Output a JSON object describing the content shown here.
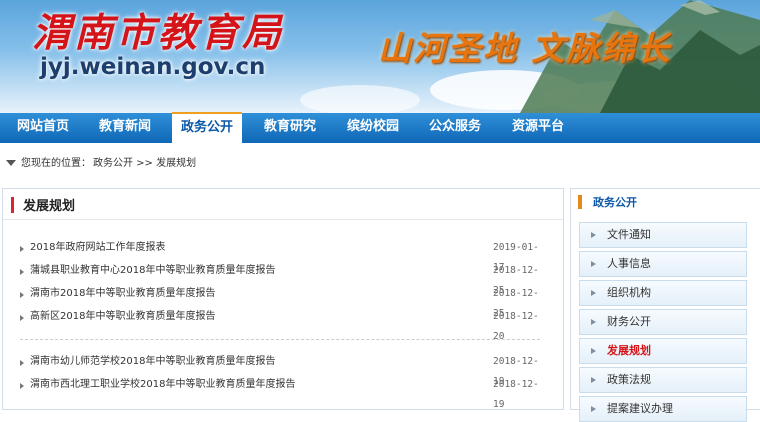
{
  "header": {
    "site_title": "渭南市教育局",
    "site_url": "jyj.weinan.gov.cn",
    "slogan": "山河圣地 文脉绵长"
  },
  "nav": {
    "items": [
      "网站首页",
      "教育新闻",
      "政务公开",
      "教育研究",
      "缤纷校园",
      "公众服务",
      "资源平台"
    ],
    "active": "政务公开"
  },
  "breadcrumb": {
    "prefix": "您现在的位置：",
    "path": "政务公开 >> 发展规划"
  },
  "main": {
    "title": "发展规划",
    "articles": [
      {
        "title": "2018年政府网站工作年度报表",
        "date": "2019-01-17"
      },
      {
        "title": "蒲城县职业教育中心2018年中等职业教育质量年度报告",
        "date": "2018-12-25"
      },
      {
        "title": "渭南市2018年中等职业教育质量年度报告",
        "date": "2018-12-25"
      },
      {
        "title": "高新区2018年中等职业教育质量年度报告",
        "date": "2018-12-20"
      },
      {
        "title": "渭南市幼儿师范学校2018年中等职业教育质量年度报告",
        "date": "2018-12-19"
      },
      {
        "title": "渭南市西北理工职业学校2018年中等职业教育质量年度报告",
        "date": "2018-12-19"
      }
    ]
  },
  "sidebar": {
    "title": "政务公开",
    "items": [
      "文件通知",
      "人事信息",
      "组织机构",
      "财务公开",
      "发展规划",
      "政策法规",
      "提案建议办理"
    ],
    "active": "发展规划"
  },
  "colors": {
    "nav_bg": "#1577c6",
    "brand_red": "#d41418",
    "accent_orange": "#e8740e",
    "link_blue": "#0c58a6"
  }
}
